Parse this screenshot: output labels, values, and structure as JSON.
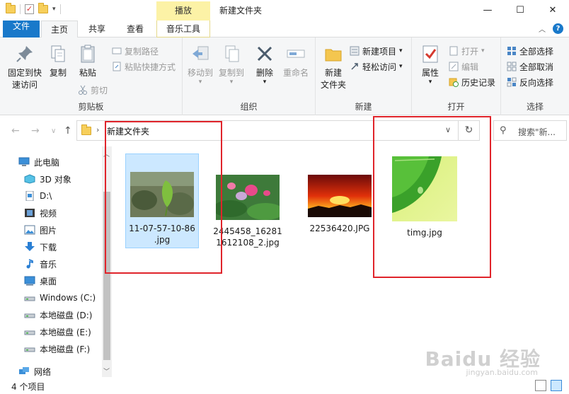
{
  "window": {
    "title": "新建文件夹",
    "context_tab": "播放",
    "controls": {
      "minimize": "—",
      "maximize": "☐",
      "close": "✕"
    }
  },
  "tabs": {
    "file": "文件",
    "home": "主页",
    "share": "共享",
    "view": "查看",
    "music_tools": "音乐工具"
  },
  "ribbon": {
    "clipboard": {
      "label": "剪贴板",
      "pin": "固定到快\n速访问",
      "copy": "复制",
      "paste": "粘贴",
      "copy_path": "复制路径",
      "paste_shortcut": "粘贴快捷方式",
      "cut": "剪切"
    },
    "organize": {
      "label": "组织",
      "move_to": "移动到",
      "copy_to": "复制到",
      "delete": "删除",
      "rename": "重命名"
    },
    "new": {
      "label": "新建",
      "new_folder": "新建\n文件夹",
      "new_item": "新建项目",
      "easy_access": "轻松访问"
    },
    "open": {
      "label": "打开",
      "properties": "属性",
      "open": "打开",
      "edit": "编辑",
      "history": "历史记录"
    },
    "select": {
      "label": "选择",
      "select_all": "全部选择",
      "select_none": "全部取消",
      "invert": "反向选择"
    }
  },
  "address": {
    "path": "新建文件夹",
    "search_placeholder": "搜索\"新..."
  },
  "nav": {
    "items": [
      {
        "label": "此电脑",
        "icon": "computer-icon"
      },
      {
        "label": "3D 对象",
        "icon": "cube-icon"
      },
      {
        "label": "D:\\",
        "icon": "document-icon"
      },
      {
        "label": "视频",
        "icon": "film-icon"
      },
      {
        "label": "图片",
        "icon": "picture-icon"
      },
      {
        "label": "下载",
        "icon": "download-icon"
      },
      {
        "label": "音乐",
        "icon": "music-icon"
      },
      {
        "label": "桌面",
        "icon": "desktop-icon"
      },
      {
        "label": "Windows (C:)",
        "icon": "drive-icon"
      },
      {
        "label": "本地磁盘 (D:)",
        "icon": "drive-icon"
      },
      {
        "label": "本地磁盘 (E:)",
        "icon": "drive-icon"
      },
      {
        "label": "本地磁盘 (F:)",
        "icon": "drive-icon"
      },
      {
        "label": "网络",
        "icon": "network-icon"
      }
    ]
  },
  "files": [
    {
      "name": "11-07-57-10-86\n.jpg",
      "icon": "leaf-photo-thumbnail"
    },
    {
      "name": "2445458_16281\n1612108_2.jpg",
      "icon": "lotus-photo-thumbnail"
    },
    {
      "name": "22536420.JPG",
      "icon": "sunset-photo-thumbnail"
    },
    {
      "name": "timg.jpg",
      "icon": "green-leaf-thumbnail"
    }
  ],
  "status": {
    "count": "4 个项目"
  },
  "watermark": {
    "main": "Baidu 经验",
    "sub": "jingyan.baidu.com"
  },
  "colors": {
    "accent": "#1979ca",
    "highlight": "#e0242b",
    "context_tab": "#fcf2a6"
  }
}
